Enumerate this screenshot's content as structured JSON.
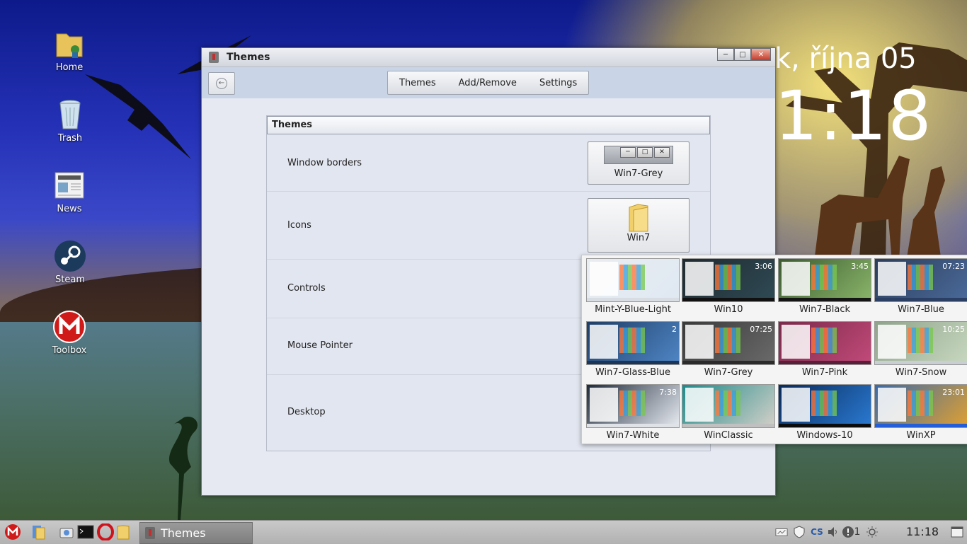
{
  "window": {
    "title": "Themes",
    "toolbar": {
      "tabs": [
        "Themes",
        "Add/Remove",
        "Settings"
      ]
    },
    "panel": {
      "header": "Themes",
      "rows": [
        {
          "label": "Window borders",
          "value": "Win7-Grey"
        },
        {
          "label": "Icons",
          "value": "Win7"
        },
        {
          "label": "Controls"
        },
        {
          "label": "Mouse Pointer"
        },
        {
          "label": "Desktop"
        }
      ]
    }
  },
  "popup": {
    "themes": [
      {
        "name": "Mint-Y-Blue-Light",
        "bg": "#e9edf2",
        "accent": "#dfe8f2",
        "taskbar": "#d8dde3",
        "clock": ""
      },
      {
        "name": "Win10",
        "bg": "#1f2a2f",
        "accent": "#2f4a55",
        "taskbar": "#111111",
        "clock": "3:06"
      },
      {
        "name": "Win7-Black",
        "bg": "#3b5a2f",
        "accent": "#8ab56a",
        "taskbar": "#151515",
        "clock": "3:45"
      },
      {
        "name": "Win7-Blue",
        "bg": "#2c3d5a",
        "accent": "#4a6a9a",
        "taskbar": "#2a3f63",
        "clock": "07:23"
      },
      {
        "name": "Win7-Glass-Blue",
        "bg": "#1f3e66",
        "accent": "#4f86c6",
        "taskbar": "#1a3558",
        "clock": "2"
      },
      {
        "name": "Win7-Grey",
        "bg": "#3a3a3a",
        "accent": "#6a6a6a",
        "taskbar": "#2b2b2b",
        "clock": "07:25"
      },
      {
        "name": "Win7-Pink",
        "bg": "#7a2a4a",
        "accent": "#c24a7a",
        "taskbar": "#5a1f38",
        "clock": ""
      },
      {
        "name": "Win7-Snow",
        "bg": "#8fa38a",
        "accent": "#c8d8c0",
        "taskbar": "#c9ced3",
        "clock": "10:25"
      },
      {
        "name": "Win7-White",
        "bg": "#1e2a3a",
        "accent": "#e8ecf2",
        "taskbar": "#dfe3e8",
        "clock": "7:38"
      },
      {
        "name": "WinClassic",
        "bg": "#1d8a8a",
        "accent": "#d4d0c8",
        "taskbar": "#c0c0c0",
        "clock": ""
      },
      {
        "name": "Windows-10",
        "bg": "#0a2a5a",
        "accent": "#2a7ad2",
        "taskbar": "#0c0c0c",
        "clock": ""
      },
      {
        "name": "WinXP",
        "bg": "#3a6aa8",
        "accent": "#e0a030",
        "taskbar": "#245ed8",
        "clock": "23:01"
      }
    ]
  },
  "desktop": {
    "icons": [
      {
        "label": "Home",
        "icon": "home-folder-icon"
      },
      {
        "label": "Trash",
        "icon": "trash-icon"
      },
      {
        "label": "News",
        "icon": "news-icon"
      },
      {
        "label": "Steam",
        "icon": "steam-icon"
      },
      {
        "label": "Toolbox",
        "icon": "toolbox-icon"
      }
    ],
    "wallpaper_date": "k, října 05",
    "wallpaper_time": "1:18"
  },
  "taskbar": {
    "task_label": "Themes",
    "keyboard_layout": "CS",
    "notification_count": "1",
    "clock": "11:18"
  }
}
